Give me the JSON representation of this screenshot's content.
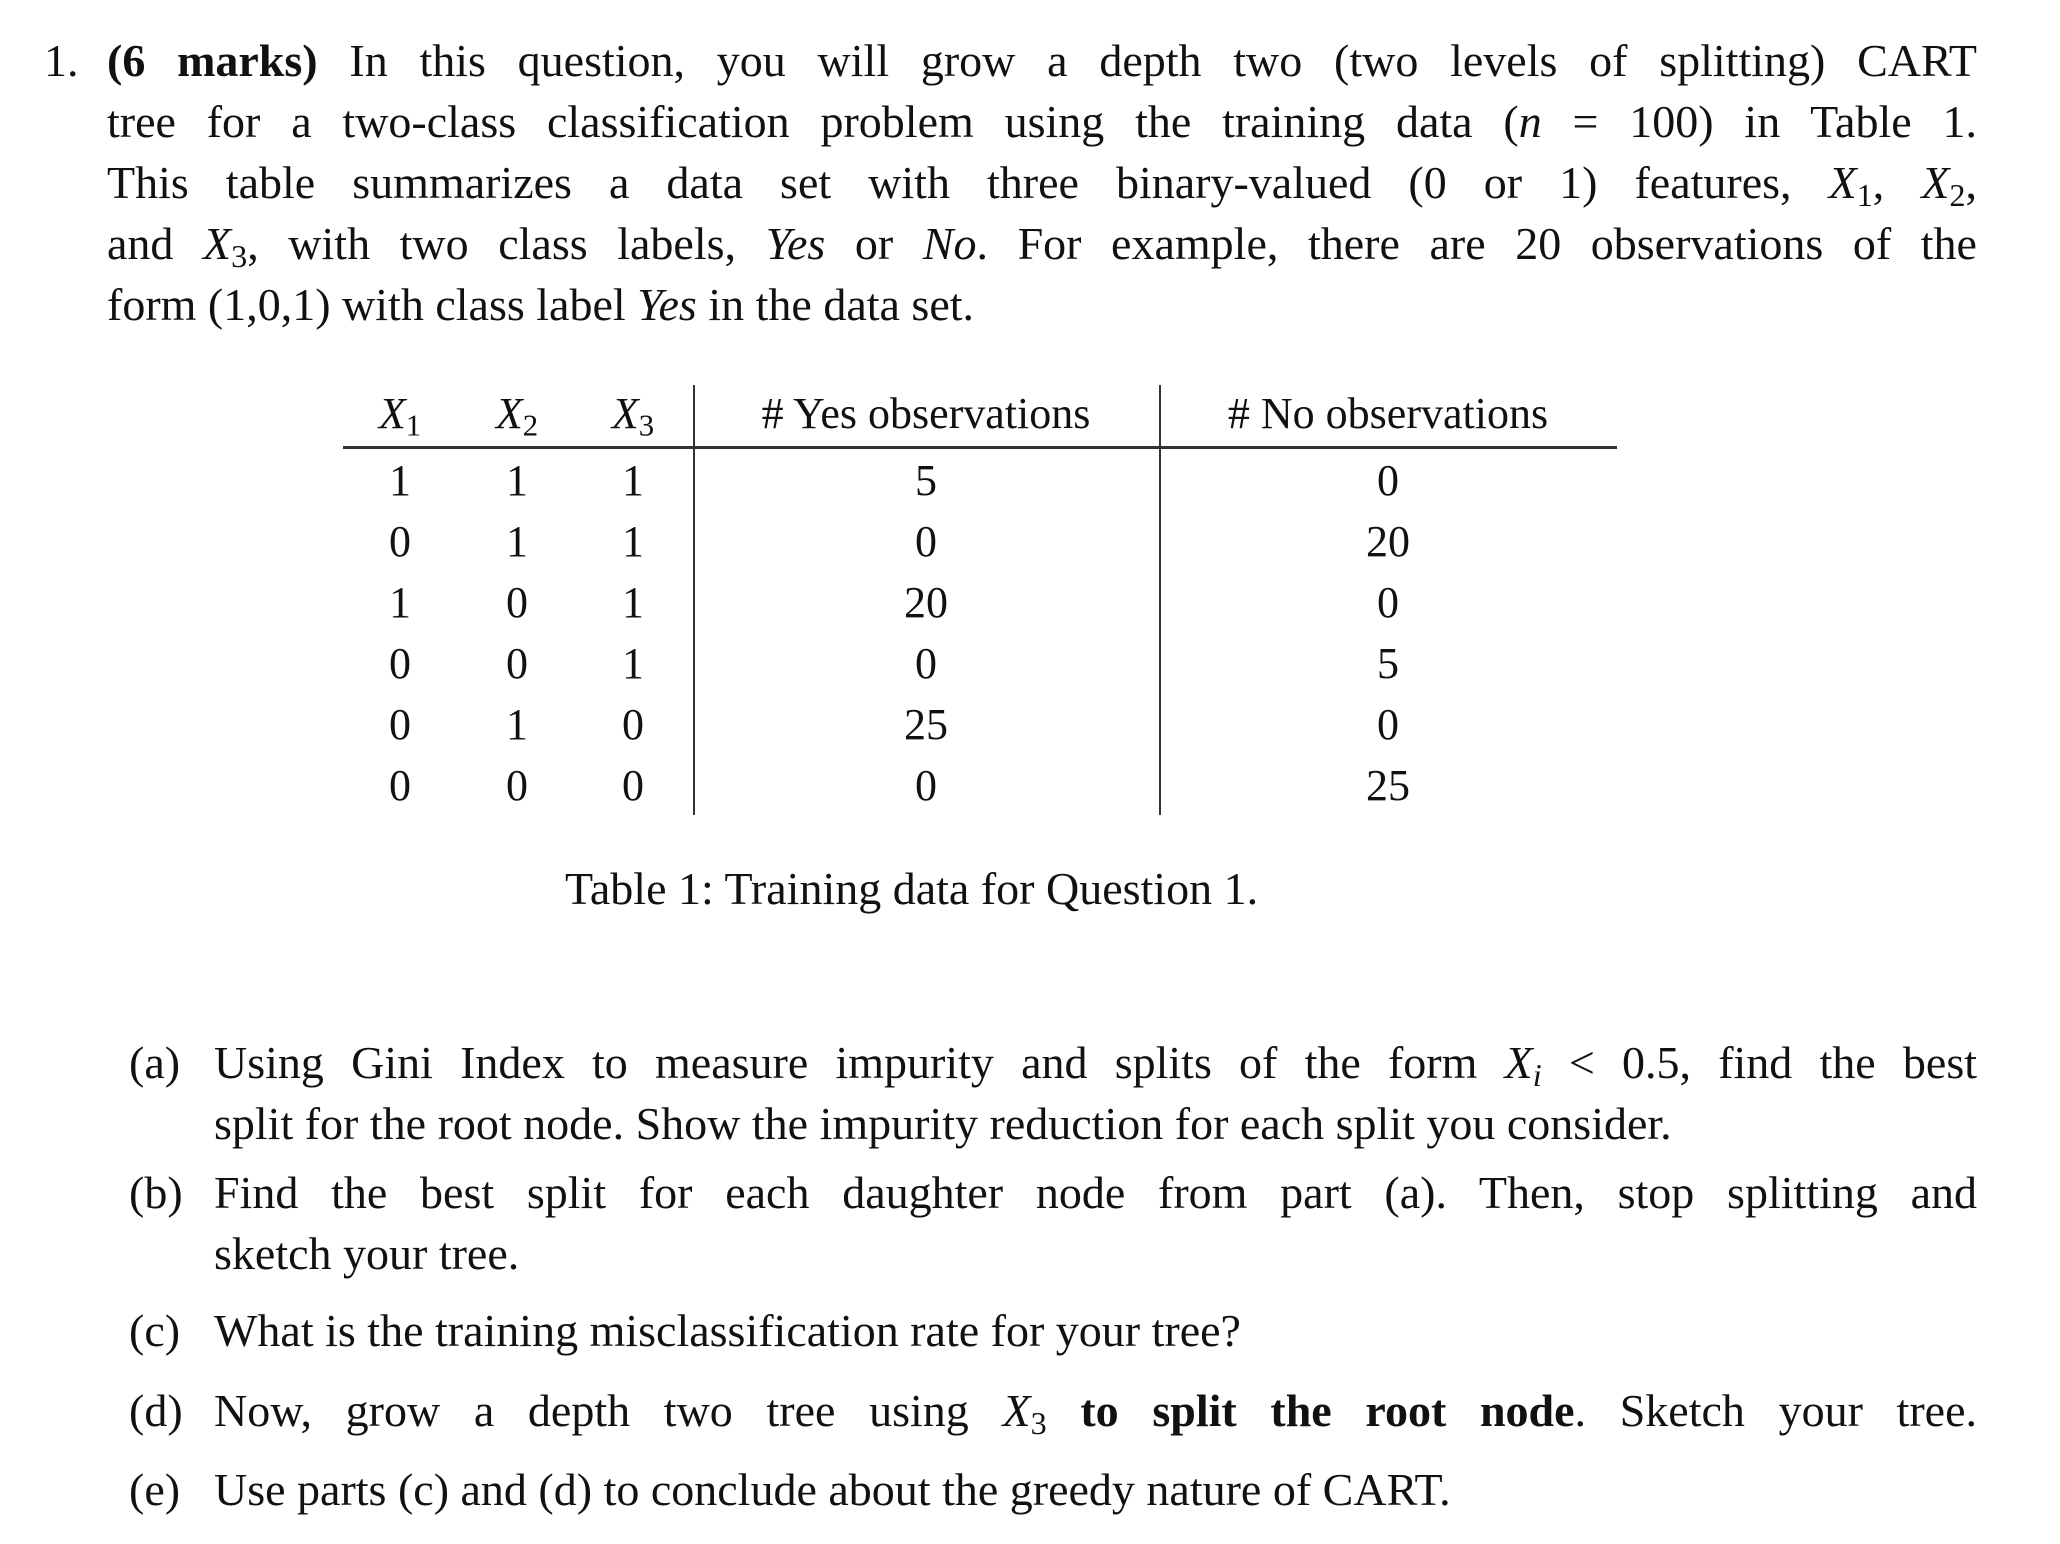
{
  "question": {
    "number": "1.",
    "marks": "(6 marks)",
    "intro_lines": [
      "In this question, you will grow a depth two (two levels of splitting) CART",
      "tree for a two-class classification problem using the training data (n = 100) in Table 1.",
      "This table summarizes a data set with three binary-valued (0 or 1) features, X1, X2,",
      "and X3, with two class labels, Yes or No. For example, there are 20 observations of the",
      "form (1,0,1) with class label Yes in the data set."
    ]
  },
  "table": {
    "headers": [
      "X1",
      "X2",
      "X3",
      "# Yes observations",
      "# No observations"
    ],
    "rows": [
      [
        "1",
        "1",
        "1",
        "5",
        "0"
      ],
      [
        "0",
        "1",
        "1",
        "0",
        "20"
      ],
      [
        "1",
        "0",
        "1",
        "20",
        "0"
      ],
      [
        "0",
        "0",
        "1",
        "0",
        "5"
      ],
      [
        "0",
        "1",
        "0",
        "25",
        "0"
      ],
      [
        "0",
        "0",
        "0",
        "0",
        "25"
      ]
    ],
    "caption": "Table 1: Training data for Question 1."
  },
  "parts": [
    {
      "label": "(a)",
      "lines": [
        "Using Gini Index to measure impurity and splits of the form Xi < 0.5, find the best",
        "split for the root node. Show the impurity reduction for each split you consider."
      ]
    },
    {
      "label": "(b)",
      "lines": [
        "Find the best split for each daughter node from part (a). Then, stop splitting and",
        "sketch your tree."
      ]
    },
    {
      "label": "(c)",
      "lines": [
        "What is the training misclassification rate for your tree?"
      ]
    },
    {
      "label": "(d)",
      "lines": [
        "Now, grow a depth two tree using X3 to split the root node. Sketch your tree."
      ]
    },
    {
      "label": "(e)",
      "lines": [
        "Use parts (c) and (d) to conclude about the greedy nature of CART."
      ]
    }
  ]
}
